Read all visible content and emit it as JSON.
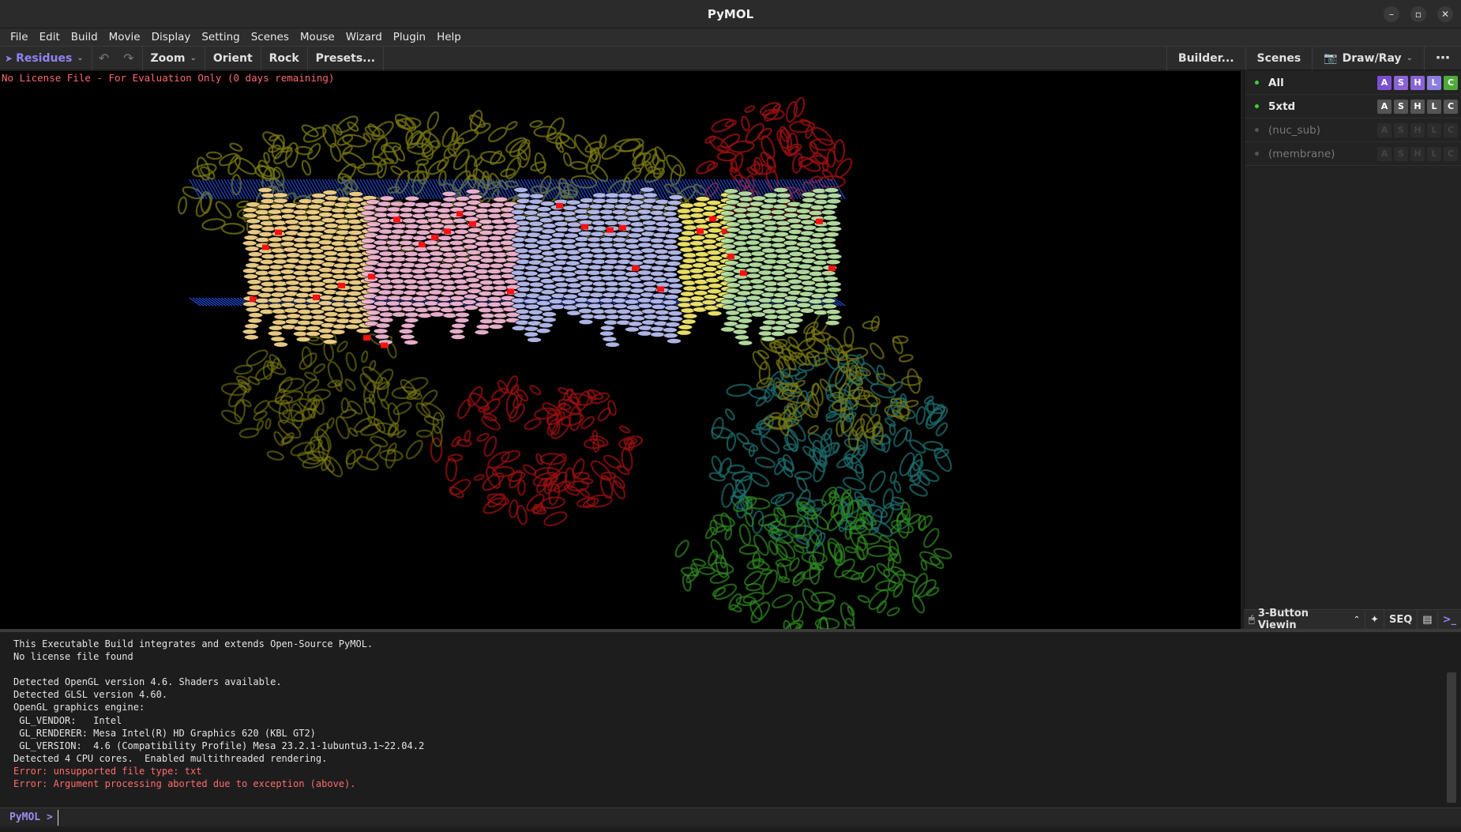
{
  "window": {
    "title": "PyMOL",
    "controls": {
      "minimize": "–",
      "maximize": "▫",
      "close": "✕"
    }
  },
  "menu": [
    "File",
    "Edit",
    "Build",
    "Movie",
    "Display",
    "Setting",
    "Scenes",
    "Mouse",
    "Wizard",
    "Plugin",
    "Help"
  ],
  "toolbar": {
    "selection_mode": "Residues",
    "undo": "↶",
    "redo": "↷",
    "zoom": "Zoom",
    "orient": "Orient",
    "rock": "Rock",
    "presets": "Presets...",
    "builder": "Builder...",
    "scenes": "Scenes",
    "draw_ray": "Draw/Ray",
    "more": "⋯"
  },
  "viewport": {
    "license_notice": "No License File - For Evaluation Only (0 days remaining)"
  },
  "objects": [
    {
      "name": "All",
      "enabled": true,
      "buttons": [
        "A",
        "S",
        "H",
        "L",
        "C"
      ]
    },
    {
      "name": "5xtd",
      "enabled": true,
      "buttons": [
        "A",
        "S",
        "H",
        "L",
        "C"
      ]
    },
    {
      "name": "(nuc_sub)",
      "enabled": false,
      "buttons": [
        "A",
        "S",
        "H",
        "L",
        "C"
      ]
    },
    {
      "name": "(membrane)",
      "enabled": false,
      "buttons": [
        "A",
        "S",
        "H",
        "L",
        "C"
      ]
    }
  ],
  "panel_bottom": {
    "mouse_mode": "3-Button Viewin",
    "seq": "SEQ"
  },
  "console": {
    "lines": [
      {
        "text": "This Executable Build integrates and extends Open-Source PyMOL.",
        "error": false
      },
      {
        "text": "No license file found",
        "error": false
      },
      {
        "text": "",
        "error": false
      },
      {
        "text": "Detected OpenGL version 4.6. Shaders available.",
        "error": false
      },
      {
        "text": "Detected GLSL version 4.60.",
        "error": false
      },
      {
        "text": "OpenGL graphics engine:",
        "error": false
      },
      {
        "text": " GL_VENDOR:   Intel",
        "error": false
      },
      {
        "text": " GL_RENDERER: Mesa Intel(R) HD Graphics 620 (KBL GT2)",
        "error": false
      },
      {
        "text": " GL_VERSION:  4.6 (Compatibility Profile) Mesa 23.2.1-1ubuntu3.1~22.04.2",
        "error": false
      },
      {
        "text": "Detected 4 CPU cores.  Enabled multithreaded rendering.",
        "error": false
      },
      {
        "text": "Error: unsupported file type: txt",
        "error": true
      },
      {
        "text": "Error: Argument processing aborted due to exception (above).",
        "error": true
      }
    ]
  },
  "command_line": {
    "prompt": "PyMOL >",
    "value": ""
  },
  "colors": {
    "accent": "#8f83f4",
    "error": "#ff6b6b",
    "enabled_dot": "#3ecf3e",
    "membrane_blue": "#2a5bff",
    "helix_wheat": "#f3d38a",
    "helix_pink": "#f2b7d4",
    "helix_lavender": "#b7bdf0",
    "helix_yellow": "#f5e96a",
    "helix_palegreen": "#b9e3a5",
    "olive": "#7a7a10",
    "red": "#9a1010",
    "teal": "#1e6e6e",
    "green": "#2f8a1f"
  }
}
